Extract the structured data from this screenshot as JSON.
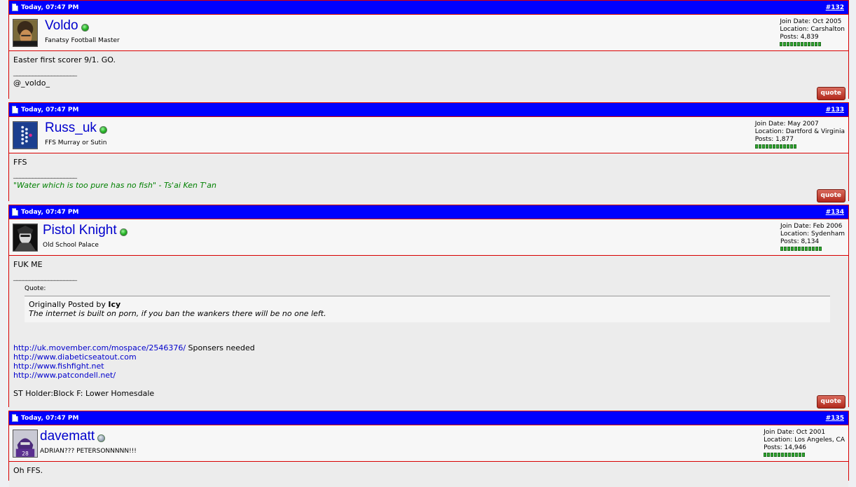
{
  "posts": [
    {
      "date": "Today, 07:47 PM",
      "number": "#132",
      "username": "Voldo",
      "online": true,
      "user_title": "Fanatsy Football Master",
      "join_date": "Join Date: Oct 2005",
      "location": "Location: Carshalton",
      "posts_count": "Posts: 4,839",
      "reputation_pips": 12,
      "message": "Easter first scorer 9/1. GO.",
      "signature_rule": "____________________",
      "signature": "@_voldo_",
      "quote_label": "quote"
    },
    {
      "date": "Today, 07:47 PM",
      "number": "#133",
      "username": "Russ_uk",
      "online": true,
      "user_title": "FFS Murray or Sutin",
      "join_date": "Join Date: May 2007",
      "location": "Location: Dartford & Virginia",
      "posts_count": "Posts: 1,877",
      "reputation_pips": 12,
      "message": "FFS",
      "signature_rule": "____________________",
      "signature": "\"Water which is too pure has no fish\" - Ts'ai Ken T'an",
      "quote_label": "quote"
    },
    {
      "date": "Today, 07:47 PM",
      "number": "#134",
      "username": "Pistol Knight",
      "online": true,
      "user_title": "Old School Palace",
      "join_date": "Join Date: Feb 2006",
      "location": "Location: Sydenham",
      "posts_count": "Posts: 8,134",
      "reputation_pips": 12,
      "message": "FUK ME",
      "signature_rule": "____________________",
      "quote": {
        "label": "Quote:",
        "originally_posted_by": "Originally Posted by",
        "author": "Icy",
        "text": "The internet is built on porn, if you ban the wankers there will be no one left."
      },
      "links": [
        {
          "url": "http://uk.movember.com/mospace/2546376/",
          "suffix": " Sponsers needed"
        },
        {
          "url": "http://www.diabeticseatout.com",
          "suffix": ""
        },
        {
          "url": "http://www.fishfight.net",
          "suffix": ""
        },
        {
          "url": "http://www.patcondell.net/",
          "suffix": ""
        }
      ],
      "signature_extra": "ST Holder:Block F: Lower Homesdale",
      "quote_label": "quote"
    },
    {
      "date": "Today, 07:47 PM",
      "number": "#135",
      "username": "davematt",
      "online": false,
      "user_title": "ADRIAN??? PETERSONNNNN!!!",
      "join_date": "Join Date: Oct 2001",
      "location": "Location: Los Angeles, CA",
      "posts_count": "Posts: 14,946",
      "reputation_pips": 12,
      "message": "Oh FFS."
    }
  ],
  "colors": {
    "header_bg": "#0000ff",
    "border": "#d80000",
    "link": "#0000cc",
    "signature_green": "#008000",
    "quote_button": "#b2291c"
  }
}
